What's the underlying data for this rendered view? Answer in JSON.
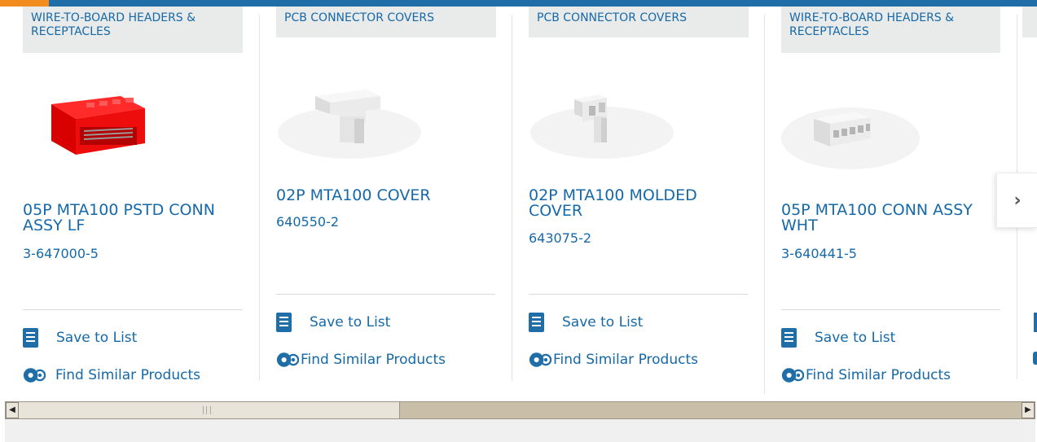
{
  "colors": {
    "accent": "#1569a8",
    "top_bar": "#1f6ea8",
    "top_bar_highlight": "#f28c1e",
    "category_bg": "#e9eaea"
  },
  "cards": [
    {
      "category": "WIRE-TO-BOARD HEADERS & RECEPTACLES",
      "title": "05P MTA100 PSTD CONN ASSY LF",
      "part_number": "3-647000-5",
      "save_label": "Save to List",
      "similar_label": "Find Similar Products",
      "image": "red-connector-header"
    },
    {
      "category": "PCB CONNECTOR COVERS",
      "title": "02P MTA100 COVER",
      "part_number": "640550-2",
      "save_label": "Save to List",
      "similar_label": "Find Similar Products",
      "image": "white-connector-cover"
    },
    {
      "category": "PCB CONNECTOR COVERS",
      "title": "02P MTA100 MOLDED COVER",
      "part_number": "643075-2",
      "save_label": "Save to List",
      "similar_label": "Find Similar Products",
      "image": "white-molded-cover"
    },
    {
      "category": "WIRE-TO-BOARD HEADERS & RECEPTACLES",
      "title": "05P MTA100 CONN ASSY WHT",
      "part_number": "3-640441-5",
      "save_label": "Save to List",
      "similar_label": "Find Similar Products",
      "image": "white-connector-assembly"
    }
  ],
  "carousel": {
    "next_icon": "chevron-right-icon",
    "next_glyph": "›"
  },
  "scrollbar": {
    "left_arrow": "◀",
    "right_arrow": "▶"
  }
}
